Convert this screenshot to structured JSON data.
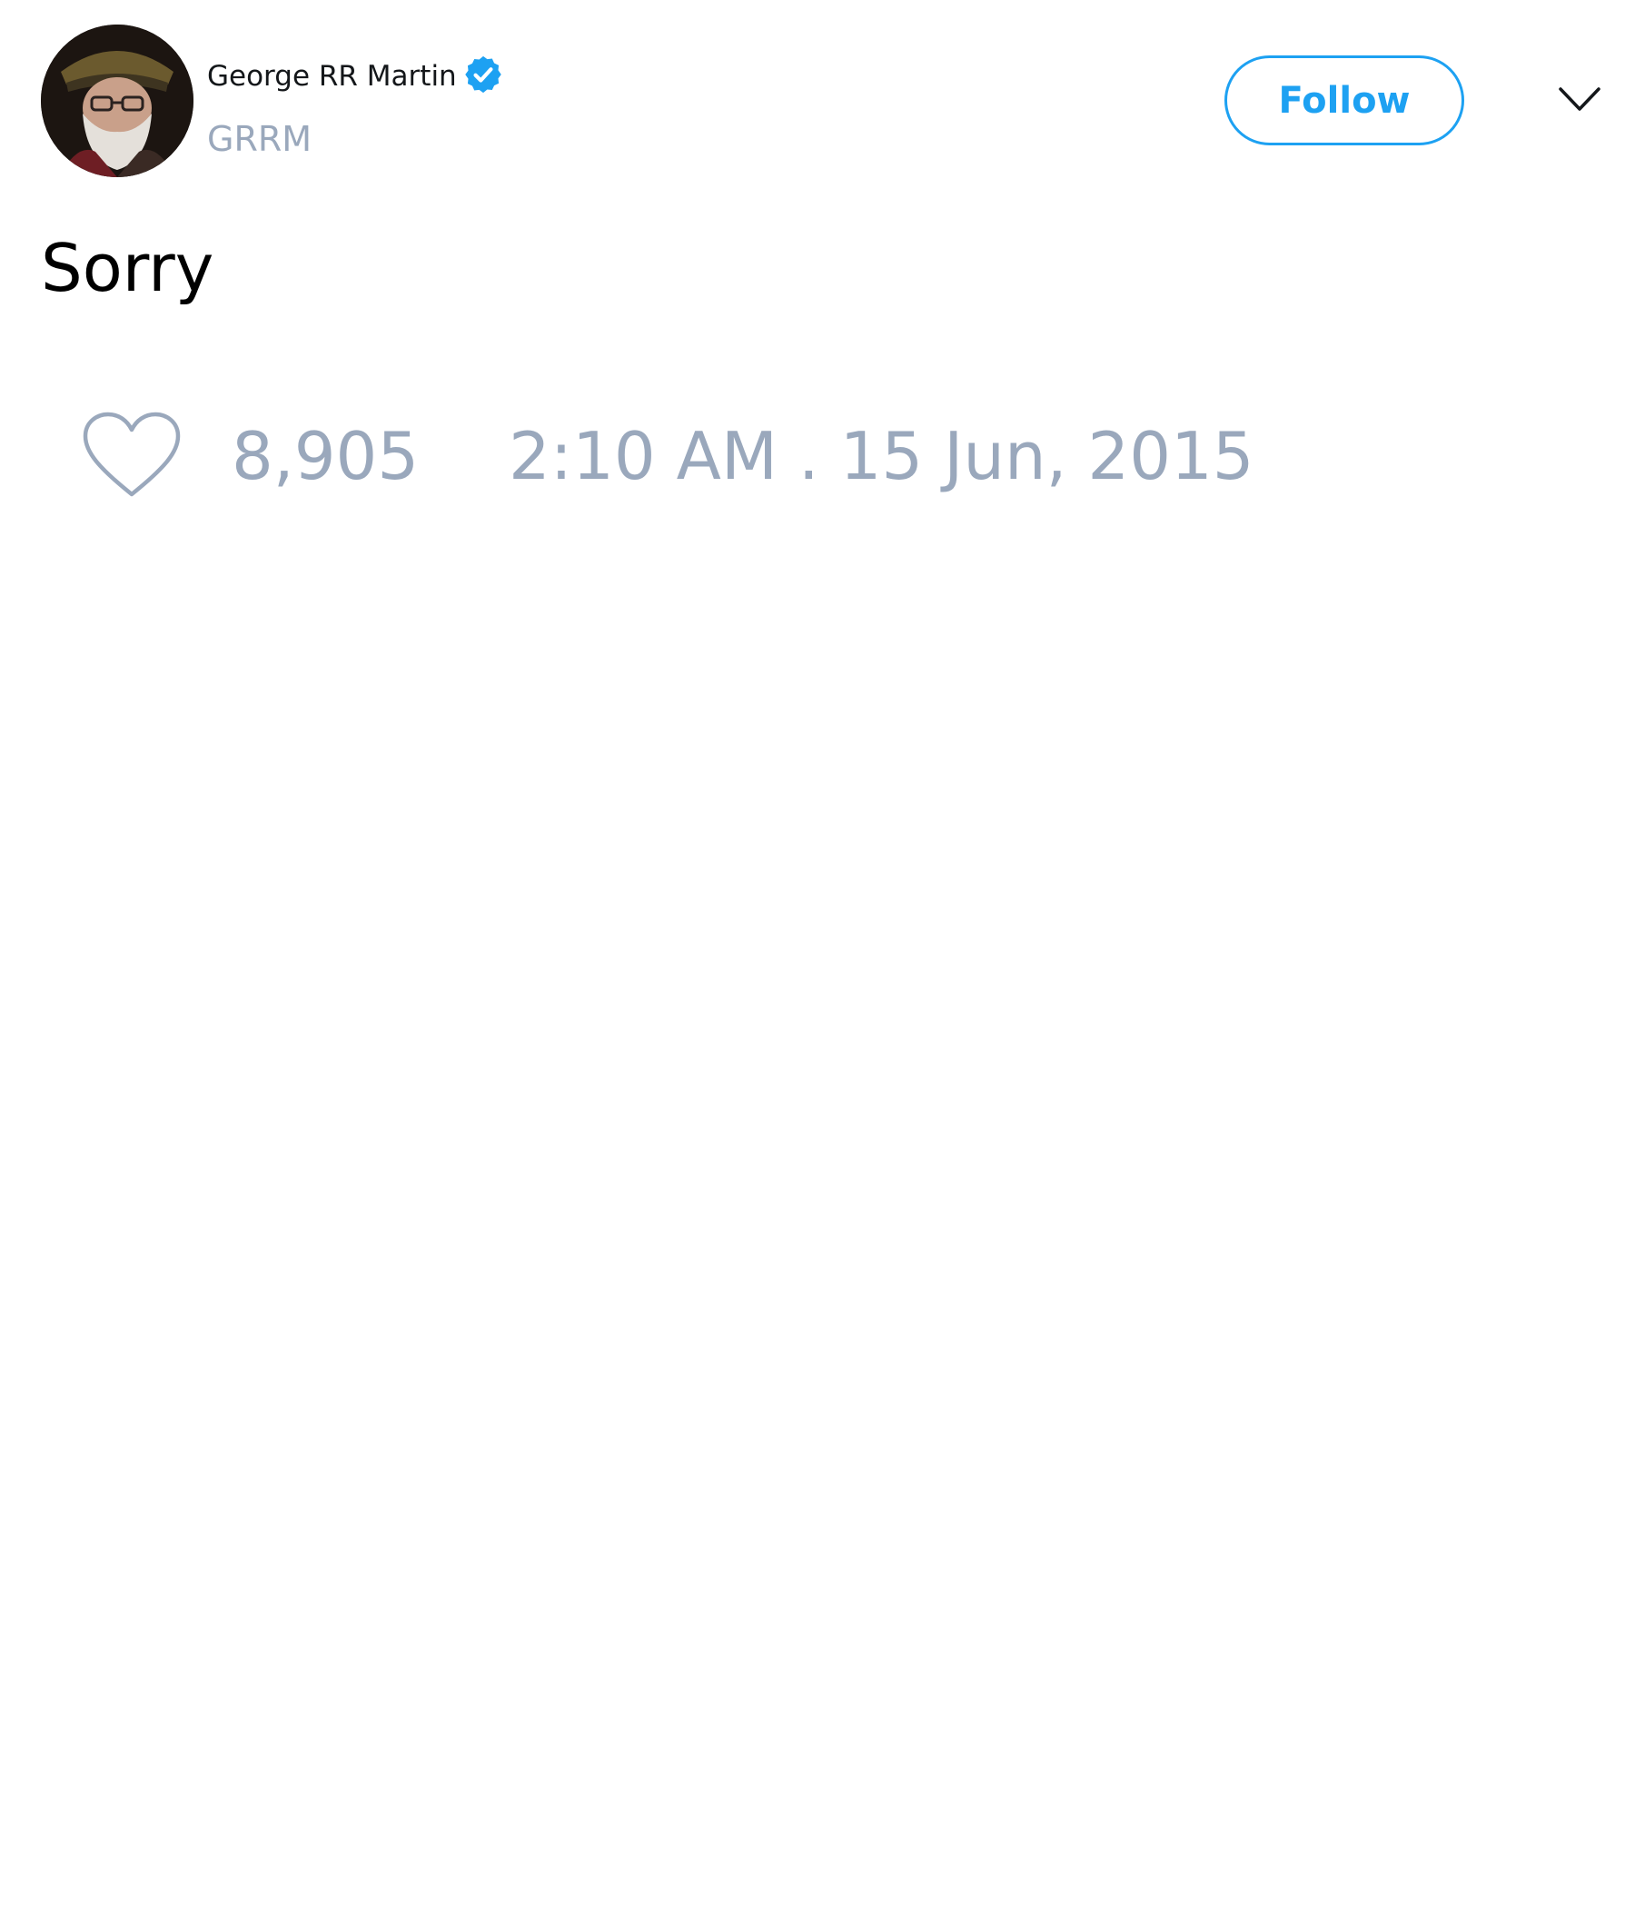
{
  "author": {
    "display_name": "George RR Martin",
    "handle": "GRRM",
    "verified": true
  },
  "actions": {
    "follow_label": "Follow"
  },
  "tweet": {
    "text": "Sorry",
    "like_count": "8,905",
    "timestamp": "2:10 AM . 15 Jun, 2015"
  },
  "icons": {
    "avatar": "profile-photo",
    "verified": "verified-badge-icon",
    "menu": "chevron-down-icon",
    "like": "heart-icon"
  },
  "colors": {
    "accent": "#1da1f2",
    "muted_text": "#9aa8bc",
    "primary_text": "#14171a"
  }
}
